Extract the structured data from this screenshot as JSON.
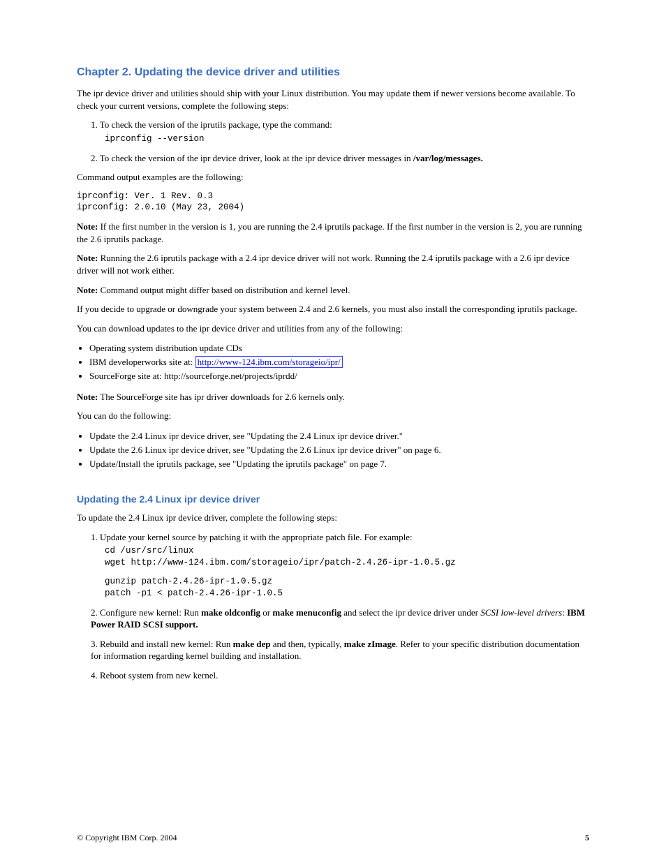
{
  "section": {
    "title": "Chapter 2. Updating the device driver and utilities",
    "subtitle": "Updating the 2.4 Linux ipr device driver"
  },
  "para": {
    "intro": "The ipr device driver and utilities should ship with your Linux distribution. You may update them if newer versions become available. To check your current versions, complete the following steps:",
    "step1": "1.  To check the version of the iprutils package, type the command:",
    "cmd1": "iprconfig --version",
    "step2_a": "2.  To check the version of the ipr device driver, look at the ipr device driver messages in ",
    "step2_b": "/var/log/messages.",
    "examplesIntro": "Command output examples are the following:",
    "examples": "iprconfig: Ver. 1 Rev. 0.3\niprconfig: 2.0.10 (May 23, 2004)",
    "note1_a": "If the first number in the version is 1, you are running the 2.4 iprutils package. If the first number in the version is 2, you are running the 2.6 iprutils package.",
    "note2_a": "Running the 2.6 iprutils package with a 2.4 ipr device driver will not work. Running the 2.4 iprutils package with a 2.6 ipr device driver will not work either.",
    "note3_a": "Command output might differ based on distribution and kernel level.",
    "kswitch_a": "If you decide to upgrade or downgrade your system between 2.4 and 2.6 kernels, you must also install the corresponding iprutils package.",
    "dlintro_a": "You can download updates to the ipr device driver and utilities from any of the following:",
    "bullet1_a": "Operating system distribution update CDs",
    "bullet2_a": "IBM developerworks site at:",
    "link": "http://www-124.ibm.com/storageio/ipr/",
    "bullet3_a": "SourceForge site at:",
    "bullet3_b": "http://sourceforge.net/projects/iprdd/",
    "sfNote_a": "The SourceForge site has ipr driver downloads for 2.6 kernels only.",
    "canDo": "You can do the following:",
    "bullet4_a": "Update the 2.4 Linux ipr device driver, see \"Updating the 2.4 Linux ipr device driver.\"",
    "bullet5_a": "Update the 2.6 Linux ipr device driver, see \"Updating the 2.6 Linux ipr device driver\" on page 6.",
    "bullet6_a": "Update/Install the iprutils package, see \"Updating the iprutils package\" on page 7.",
    "sectionIntro": "To update the 2.4 Linux ipr device driver, complete the following steps:",
    "s1": "1.  Update your kernel source by patching it with the appropriate patch file. For example:",
    "code1": "cd /usr/src/linux\nwget http://www-124.ibm.com/storageio/ipr/patch-2.4.26-ipr-1.0.5.gz",
    "code2": "gunzip patch-2.4.26-ipr-1.0.5.gz\npatch -p1 < patch-2.4.26-ipr-1.0.5",
    "s2_a": "2.  Configure new kernel: Run ",
    "s2_b": "make oldconfig",
    "s2_c": " or ",
    "s2_d": "make menuconfig",
    "s2_e": " and select the ipr device driver under ",
    "s2_f": "SCSI low-level drivers",
    "s2_g": ": ",
    "s2_h": "IBM Power RAID SCSI support.",
    "s3_a": "3.  Rebuild and install new kernel: Run ",
    "s3_b": "make dep",
    "s3_c": " and then, typically, ",
    "s3_d": "make zImage",
    "s3_e": ". Refer to your specific distribution documentation for information regarding kernel building and installation.",
    "s4": "4.  Reboot system from new kernel.",
    "noteLabel": "Note:"
  },
  "footer": {
    "copyright": "© Copyright IBM Corp. 2004",
    "page": "5"
  }
}
